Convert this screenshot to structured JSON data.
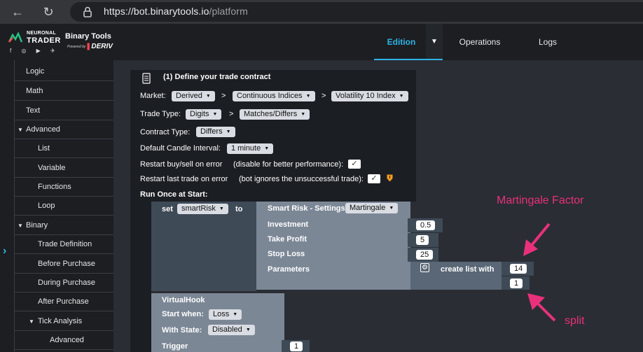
{
  "browser": {
    "url_host": "https://bot.binarytools.io",
    "url_path": "/platform"
  },
  "header": {
    "logo_line1": "NEURONAL",
    "logo_line2": "TRADER",
    "logo_social": "f ◎ ▶ ✈",
    "brand_title": "Binary Tools",
    "powered_by": "Powered by",
    "deriv": "DERIV",
    "tabs": [
      {
        "label": "Edition"
      },
      {
        "label": "Operations"
      },
      {
        "label": "Logs"
      }
    ],
    "accent_color": "#2eb4e6"
  },
  "sidebar": {
    "items": [
      {
        "label": "Logic"
      },
      {
        "label": "Math"
      },
      {
        "label": "Text"
      },
      {
        "label": "Advanced"
      },
      {
        "label": "List"
      },
      {
        "label": "Variable"
      },
      {
        "label": "Functions"
      },
      {
        "label": "Loop"
      },
      {
        "label": "Binary"
      },
      {
        "label": "Trade Definition"
      },
      {
        "label": "Before Purchase"
      },
      {
        "label": "During Purchase"
      },
      {
        "label": "After Purchase"
      },
      {
        "label": "Tick Analysis"
      },
      {
        "label": "Advanced"
      }
    ]
  },
  "trade_block": {
    "title": "(1) Define your trade contract",
    "market_label": "Market:",
    "market": "Derived",
    "submarket": "Continuous Indices",
    "symbol": "Volatility 10 Index",
    "sep": ">",
    "trade_type_label": "Trade Type:",
    "trade_type": "Digits",
    "contract": "Matches/Differs",
    "contract_type_label": "Contract Type:",
    "contract_type": "Differs",
    "candle_label": "Default Candle Interval:",
    "candle": "1 minute",
    "restart_buy_label": "Restart buy/sell on error",
    "restart_buy_hint": "(disable for better performance):",
    "restart_last_label": "Restart last trade on error",
    "restart_last_hint": "(bot ignores the unsuccessful trade):",
    "check": "✓",
    "run_once_label": "Run Once at Start:"
  },
  "set_block": {
    "set_label": "set",
    "variable": "smartRisk",
    "to_label": "to"
  },
  "smart_risk": {
    "title": "Smart Risk - Settings",
    "mode": "Martingale",
    "investment_label": "Investment",
    "investment": "0.5",
    "take_profit_label": "Take Profit",
    "take_profit": "5",
    "stop_loss_label": "Stop Loss",
    "stop_loss": "25",
    "parameters_label": "Parameters",
    "create_list_label": "create list with",
    "list_item_1": "14",
    "list_item_2": "1"
  },
  "virtual_hook": {
    "title": "VirtualHook",
    "start_when_label": "Start when:",
    "start_when": "Loss",
    "with_state_label": "With State:",
    "with_state": "Disabled",
    "trigger_label": "Trigger",
    "trigger": "1"
  },
  "annotations": {
    "martingale_factor": "Martingale Factor",
    "split": "split",
    "color": "#e8317a"
  }
}
